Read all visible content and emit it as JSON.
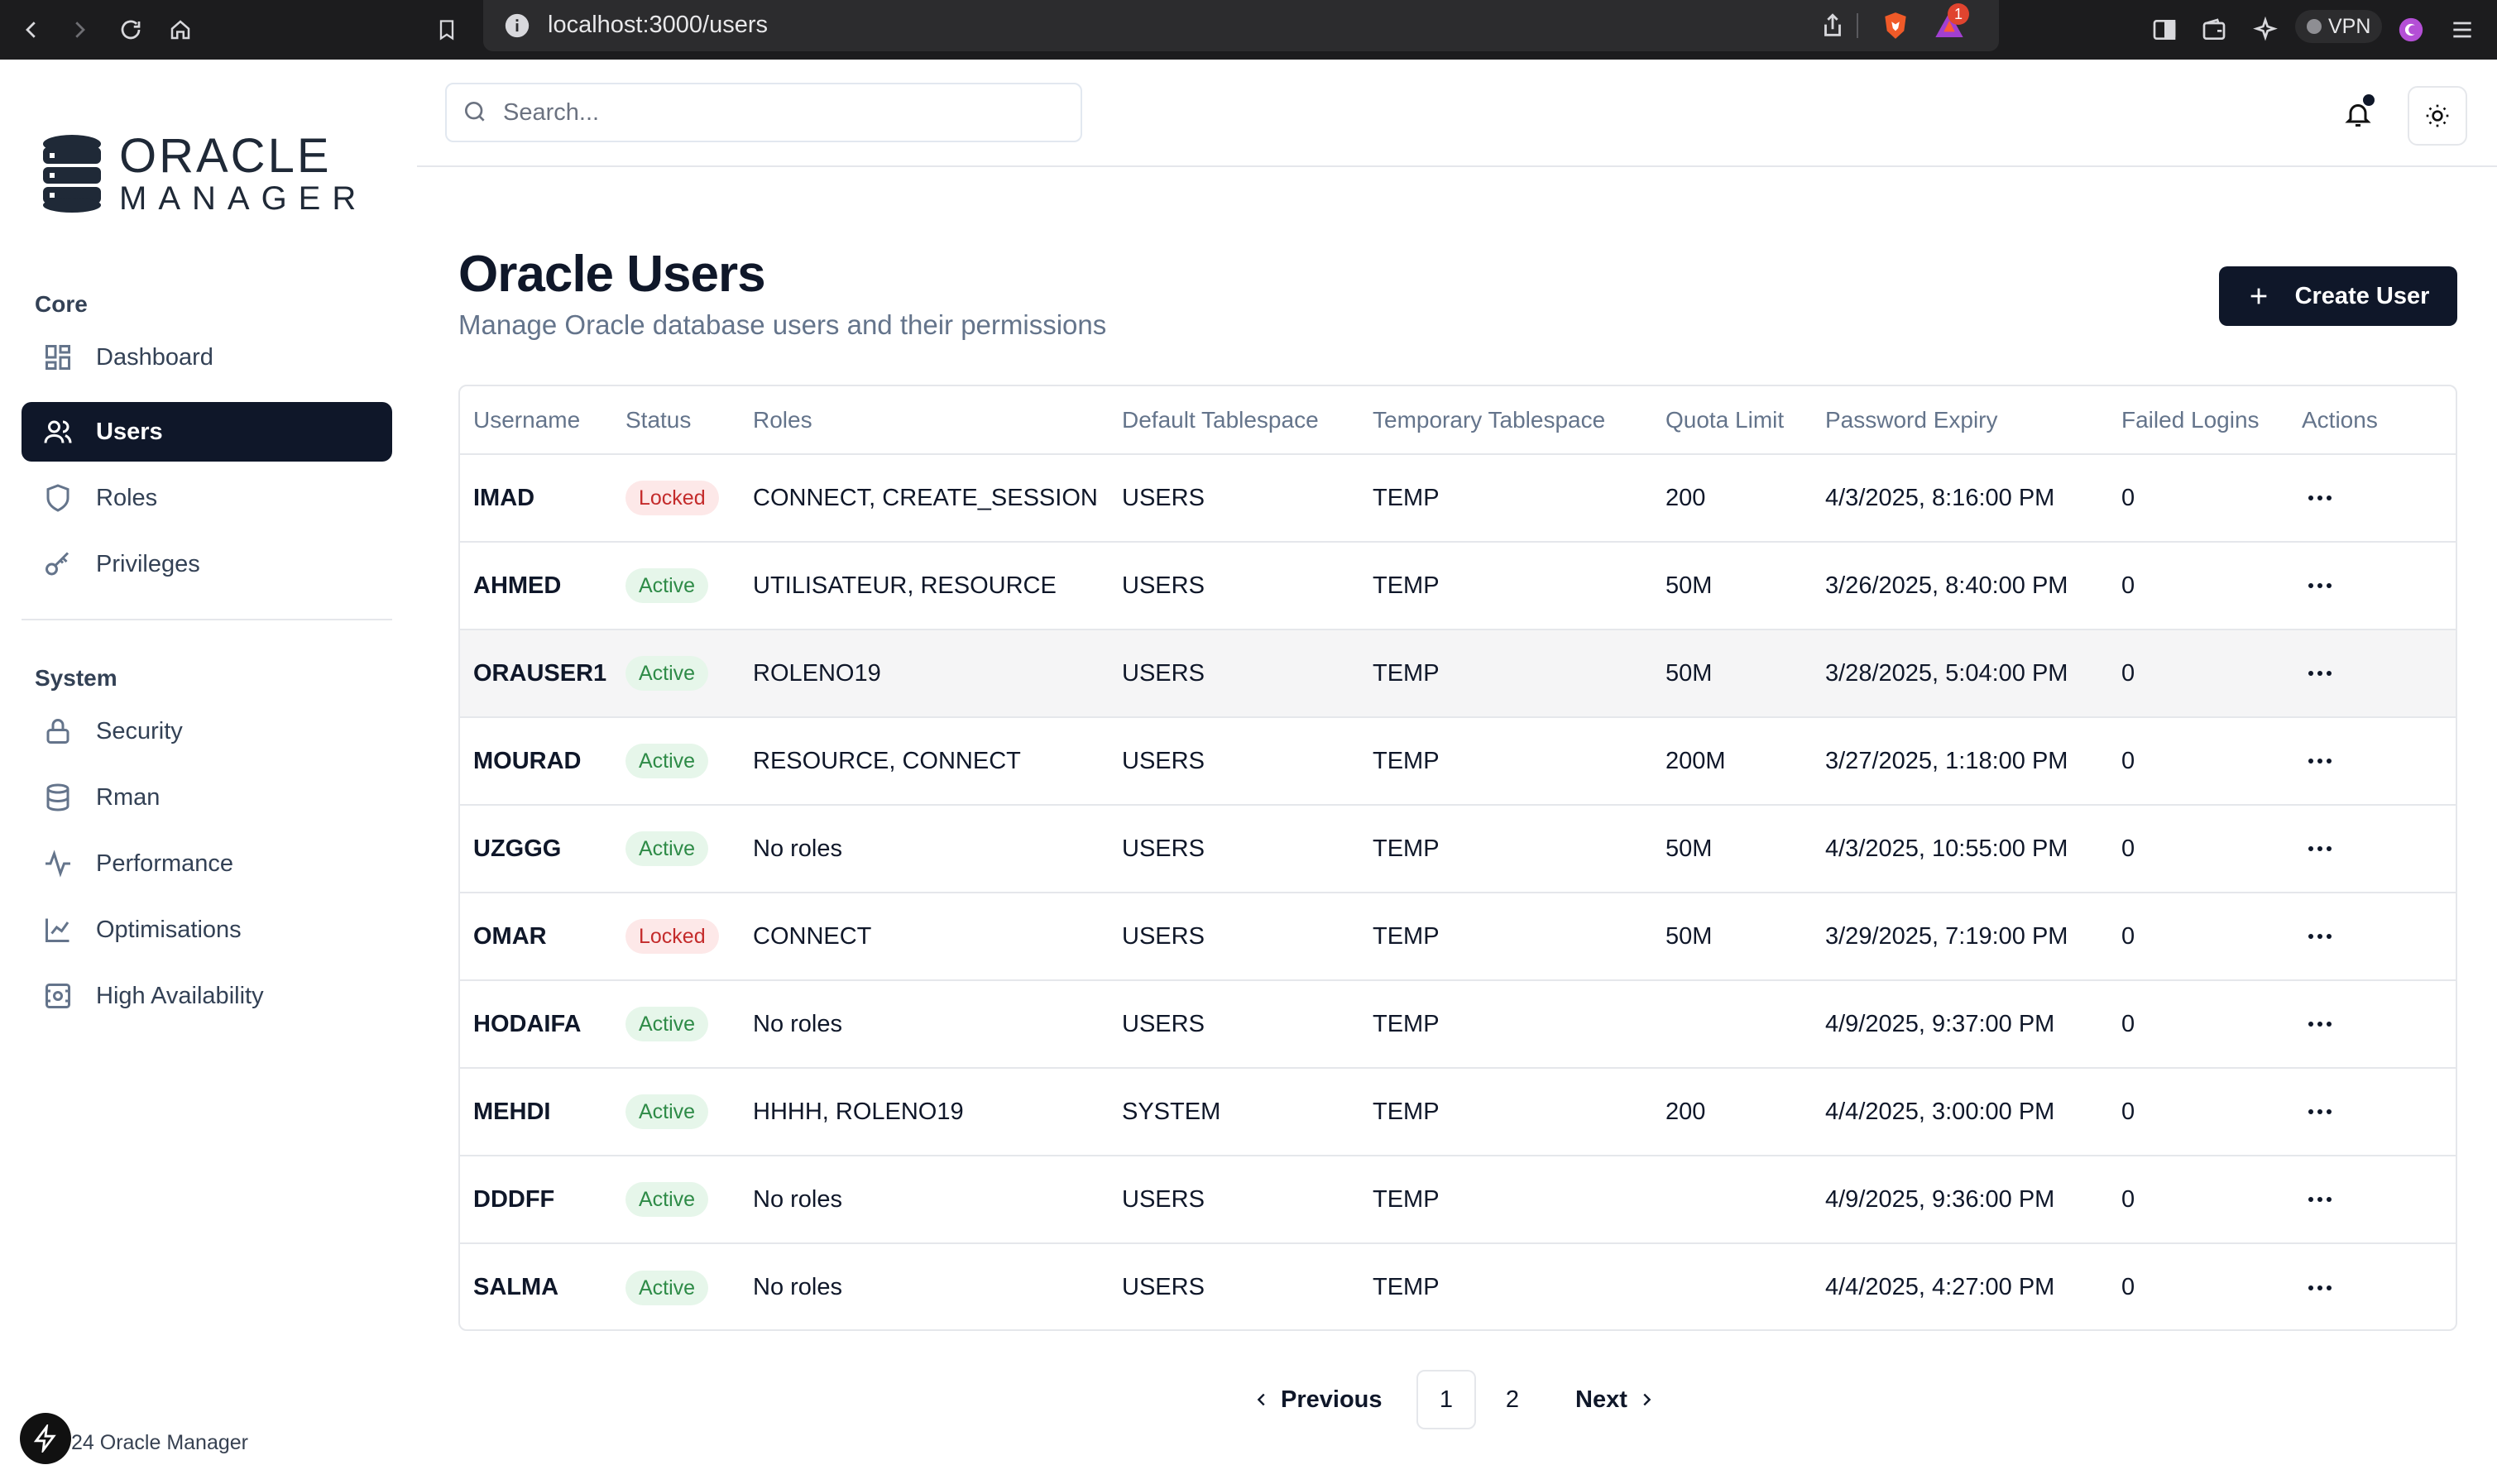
{
  "browser": {
    "url": "localhost:3000/users",
    "notification_count": "1",
    "vpn_label": "VPN"
  },
  "brand": {
    "line1": "ORACLE",
    "line2": "MANAGER"
  },
  "sidebar": {
    "core_label": "Core",
    "core_items": [
      {
        "label": "Dashboard",
        "icon": "dashboard-icon"
      },
      {
        "label": "Users",
        "icon": "users-icon",
        "active": true
      },
      {
        "label": "Roles",
        "icon": "shield-icon"
      },
      {
        "label": "Privileges",
        "icon": "key-icon"
      }
    ],
    "system_label": "System",
    "system_items": [
      {
        "label": "Security",
        "icon": "lock-icon"
      },
      {
        "label": "Rman",
        "icon": "database-icon"
      },
      {
        "label": "Performance",
        "icon": "activity-icon"
      },
      {
        "label": "Optimisations",
        "icon": "line-chart-icon"
      },
      {
        "label": "High Availability",
        "icon": "server-icon"
      }
    ],
    "footer": "24 Oracle Manager"
  },
  "topbar": {
    "search_placeholder": "Search..."
  },
  "page": {
    "title": "Oracle Users",
    "subtitle": "Manage Oracle database users and their permissions",
    "create_button": "Create User"
  },
  "table": {
    "columns": [
      "Username",
      "Status",
      "Roles",
      "Default Tablespace",
      "Temporary Tablespace",
      "Quota Limit",
      "Password Expiry",
      "Failed Logins",
      "Actions"
    ],
    "rows": [
      {
        "username": "IMAD",
        "status": "Locked",
        "roles": "CONNECT, CREATE_SESSION",
        "default_ts": "USERS",
        "temp_ts": "TEMP",
        "quota": "200",
        "expiry": "4/3/2025, 8:16:00 PM",
        "failed": "0"
      },
      {
        "username": "AHMED",
        "status": "Active",
        "roles": "UTILISATEUR, RESOURCE",
        "default_ts": "USERS",
        "temp_ts": "TEMP",
        "quota": "50M",
        "expiry": "3/26/2025, 8:40:00 PM",
        "failed": "0"
      },
      {
        "username": "ORAUSER1",
        "status": "Active",
        "roles": "ROLENO19",
        "default_ts": "USERS",
        "temp_ts": "TEMP",
        "quota": "50M",
        "expiry": "3/28/2025, 5:04:00 PM",
        "failed": "0"
      },
      {
        "username": "MOURAD",
        "status": "Active",
        "roles": "RESOURCE, CONNECT",
        "default_ts": "USERS",
        "temp_ts": "TEMP",
        "quota": "200M",
        "expiry": "3/27/2025, 1:18:00 PM",
        "failed": "0"
      },
      {
        "username": "UZGGG",
        "status": "Active",
        "roles": "No roles",
        "default_ts": "USERS",
        "temp_ts": "TEMP",
        "quota": "50M",
        "expiry": "4/3/2025, 10:55:00 PM",
        "failed": "0"
      },
      {
        "username": "OMAR",
        "status": "Locked",
        "roles": "CONNECT",
        "default_ts": "USERS",
        "temp_ts": "TEMP",
        "quota": "50M",
        "expiry": "3/29/2025, 7:19:00 PM",
        "failed": "0"
      },
      {
        "username": "HODAIFA",
        "status": "Active",
        "roles": "No roles",
        "default_ts": "USERS",
        "temp_ts": "TEMP",
        "quota": "",
        "expiry": "4/9/2025, 9:37:00 PM",
        "failed": "0"
      },
      {
        "username": "MEHDI",
        "status": "Active",
        "roles": "HHHH, ROLENO19",
        "default_ts": "SYSTEM",
        "temp_ts": "TEMP",
        "quota": "200",
        "expiry": "4/4/2025, 3:00:00 PM",
        "failed": "0"
      },
      {
        "username": "DDDFF",
        "status": "Active",
        "roles": "No roles",
        "default_ts": "USERS",
        "temp_ts": "TEMP",
        "quota": "",
        "expiry": "4/9/2025, 9:36:00 PM",
        "failed": "0"
      },
      {
        "username": "SALMA",
        "status": "Active",
        "roles": "No roles",
        "default_ts": "USERS",
        "temp_ts": "TEMP",
        "quota": "",
        "expiry": "4/4/2025, 4:27:00 PM",
        "failed": "0"
      }
    ]
  },
  "pagination": {
    "previous": "Previous",
    "pages": [
      "1",
      "2"
    ],
    "current": "1",
    "next": "Next"
  },
  "colors": {
    "primary": "#0f1729",
    "locked_bg": "#fde8e8",
    "locked_text": "#c42b2b",
    "active_bg": "#e6f6ea",
    "active_text": "#2e8b47"
  }
}
